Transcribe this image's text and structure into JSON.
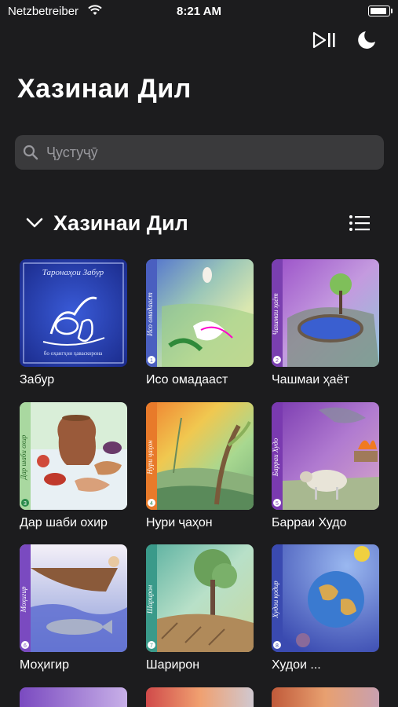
{
  "status": {
    "carrier": "Netzbetreiber",
    "time": "8:21 AM",
    "battery_level": 1.0
  },
  "header": {
    "play_icon": "play-pause-icon",
    "theme_icon": "moon-icon"
  },
  "page": {
    "title": "Хазинаи Дил"
  },
  "search": {
    "placeholder": "Ҷустуҷӯ",
    "value": "",
    "icon": "search-icon"
  },
  "section": {
    "title": "Хазинаи Дил",
    "collapse_icon": "chevron-down-icon",
    "view_icon": "list-icon"
  },
  "items": [
    {
      "label": "Забур",
      "cover_text": "Таронаҳои Забур",
      "cover_sub": "бо оҳангҳои ҳаваскорона",
      "badge": ""
    },
    {
      "label": "Исо омадааст",
      "cover_text": "Исо омадааст",
      "cover_sub": "",
      "badge": "1"
    },
    {
      "label": "Чашмаи ҳаёт",
      "cover_text": "Чашмаи ҳаёт",
      "cover_sub": "",
      "badge": "2"
    },
    {
      "label": "Дар шаби охир",
      "cover_text": "Дар шаби охир",
      "cover_sub": "",
      "badge": "3"
    },
    {
      "label": "Нури ҷаҳон",
      "cover_text": "Нури ҷаҳон",
      "cover_sub": "",
      "badge": "4"
    },
    {
      "label": "Барраи Худо",
      "cover_text": "Барраи Худо",
      "cover_sub": "",
      "badge": "5"
    },
    {
      "label": "Моҳигир",
      "cover_text": "Моҳигир",
      "cover_sub": "",
      "badge": "6"
    },
    {
      "label": "Шарирон",
      "cover_text": "Шарирон",
      "cover_sub": "",
      "badge": "7"
    },
    {
      "label": "Худои ...",
      "cover_text": "Худои қодир",
      "cover_sub": "",
      "badge": "8"
    }
  ],
  "colors": {
    "background": "#1c1c1e",
    "search_bg": "#3a3a3c",
    "placeholder": "#98989d"
  }
}
